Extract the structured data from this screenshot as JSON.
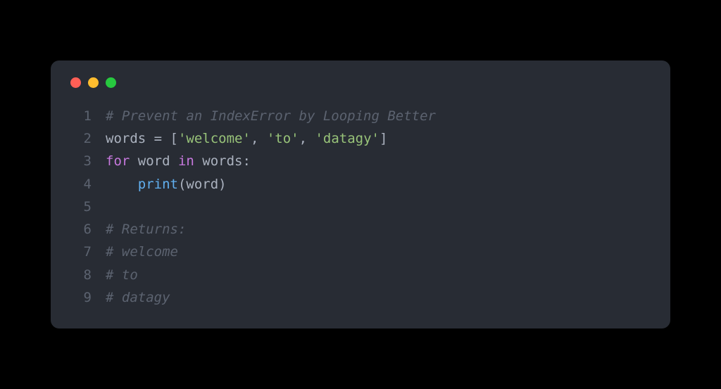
{
  "window": {
    "controls": [
      "close",
      "minimize",
      "maximize"
    ]
  },
  "code": {
    "lines": [
      {
        "num": "1",
        "tokens": [
          {
            "cls": "tok-comment",
            "text": "# Prevent an IndexError by Looping Better"
          }
        ]
      },
      {
        "num": "2",
        "tokens": [
          {
            "cls": "tok-default",
            "text": "words "
          },
          {
            "cls": "tok-op",
            "text": "="
          },
          {
            "cls": "tok-default",
            "text": " ["
          },
          {
            "cls": "tok-string",
            "text": "'welcome'"
          },
          {
            "cls": "tok-default",
            "text": ", "
          },
          {
            "cls": "tok-string",
            "text": "'to'"
          },
          {
            "cls": "tok-default",
            "text": ", "
          },
          {
            "cls": "tok-string",
            "text": "'datagy'"
          },
          {
            "cls": "tok-default",
            "text": "]"
          }
        ]
      },
      {
        "num": "3",
        "tokens": [
          {
            "cls": "tok-keyword",
            "text": "for"
          },
          {
            "cls": "tok-default",
            "text": " word "
          },
          {
            "cls": "tok-keyword",
            "text": "in"
          },
          {
            "cls": "tok-default",
            "text": " words:"
          }
        ]
      },
      {
        "num": "4",
        "tokens": [
          {
            "cls": "tok-default",
            "text": "    "
          },
          {
            "cls": "tok-func",
            "text": "print"
          },
          {
            "cls": "tok-default",
            "text": "(word)"
          }
        ]
      },
      {
        "num": "5",
        "tokens": []
      },
      {
        "num": "6",
        "tokens": [
          {
            "cls": "tok-comment",
            "text": "# Returns:"
          }
        ]
      },
      {
        "num": "7",
        "tokens": [
          {
            "cls": "tok-comment",
            "text": "# welcome"
          }
        ]
      },
      {
        "num": "8",
        "tokens": [
          {
            "cls": "tok-comment",
            "text": "# to"
          }
        ]
      },
      {
        "num": "9",
        "tokens": [
          {
            "cls": "tok-comment",
            "text": "# datagy"
          }
        ]
      }
    ]
  }
}
